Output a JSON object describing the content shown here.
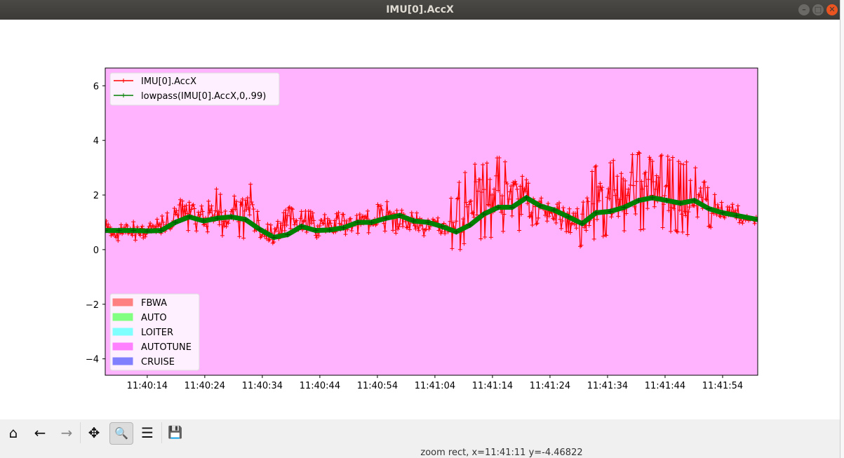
{
  "window": {
    "title": "IMU[0].AccX"
  },
  "toolbar": {
    "home": "⌂",
    "back": "←",
    "forward": "→",
    "pan": "✥",
    "zoom": "🔍",
    "configure": "☰",
    "save": "💾"
  },
  "status": "zoom rect, x=11:41:11 y=-4.46822",
  "chart_data": {
    "type": "line",
    "title": "",
    "xlabel": "",
    "ylabel": "",
    "x_unit": "seconds after 11:40:00",
    "xlim": [
      6.7,
      120.1
    ],
    "ylim": [
      -4.6,
      6.65
    ],
    "background": "#ffb3ff",
    "yticks": [
      6,
      4,
      2,
      0,
      -2,
      -4
    ],
    "ytick_labels": [
      "6",
      "4",
      "2",
      "0",
      "−2",
      "−4"
    ],
    "xticks": [
      14,
      24,
      34,
      44,
      54,
      64,
      74,
      84,
      94,
      104,
      114
    ],
    "xtick_labels": [
      "11:40:14",
      "11:40:24",
      "11:40:34",
      "11:40:44",
      "11:40:54",
      "11:41:04",
      "11:41:14",
      "11:41:24",
      "11:41:34",
      "11:41:44",
      "11:41:54"
    ],
    "x": [
      6.7,
      9.1,
      11.6,
      14,
      16.4,
      18.9,
      21.3,
      23.8,
      26.2,
      28.6,
      31.1,
      33.5,
      36,
      38.4,
      40.8,
      43.3,
      45.7,
      48.1,
      50.6,
      53,
      55.5,
      57.9,
      60.3,
      62.8,
      65.2,
      67.7,
      70.1,
      72.5,
      75,
      77.4,
      79.9,
      82.3,
      84.7,
      87.2,
      89.6,
      92,
      94.5,
      96.9,
      99.4,
      101.8,
      104.3,
      106.7,
      109.1,
      111.6,
      114,
      116.4,
      120.1
    ],
    "series": [
      {
        "name": "IMU[0].AccX",
        "color": "#ff0000",
        "kind": "envelope",
        "high": [
          1.1,
          1.1,
          1.1,
          1.0,
          1.2,
          1.7,
          2.1,
          1.6,
          2.3,
          1.7,
          3.1,
          1.2,
          0.9,
          1.6,
          1.5,
          1.5,
          1.3,
          1.4,
          1.5,
          1.6,
          1.8,
          1.5,
          1.4,
          1.3,
          1.2,
          2.5,
          3.1,
          3.3,
          3.5,
          3.3,
          2.6,
          1.9,
          1.8,
          1.6,
          2.5,
          3.1,
          3.2,
          3.7,
          3.6,
          3.4,
          3.5,
          3.3,
          3.2,
          2.2,
          1.8,
          1.7,
          1.5
        ],
        "low": [
          0.3,
          0.3,
          0.3,
          0.3,
          0.4,
          0.6,
          0.6,
          0.6,
          0.5,
          0.5,
          0.3,
          0.2,
          0.1,
          0.2,
          0.3,
          0.4,
          0.4,
          0.5,
          0.6,
          0.6,
          0.6,
          0.6,
          0.5,
          0.5,
          0.3,
          -0.15,
          0.3,
          0.4,
          0.5,
          0.6,
          0.8,
          0.9,
          0.9,
          0.6,
          0.0,
          0.4,
          0.5,
          0.6,
          0.6,
          0.8,
          0.7,
          0.5,
          0.6,
          0.8,
          0.9,
          0.9,
          0.8
        ]
      },
      {
        "name": "lowpass(IMU[0].AccX,0,.99)",
        "color": "#008000",
        "values": [
          0.7,
          0.7,
          0.7,
          0.68,
          0.7,
          1.0,
          1.2,
          1.05,
          1.15,
          1.2,
          1.1,
          0.75,
          0.45,
          0.55,
          0.85,
          0.7,
          0.72,
          0.8,
          1.0,
          1.0,
          1.15,
          1.25,
          1.05,
          1.0,
          0.85,
          0.65,
          0.9,
          1.3,
          1.55,
          1.55,
          1.9,
          1.6,
          1.45,
          1.2,
          0.95,
          1.35,
          1.4,
          1.55,
          1.8,
          1.9,
          1.8,
          1.7,
          1.8,
          1.5,
          1.35,
          1.25,
          1.1
        ]
      }
    ],
    "legend": {
      "placement": "upper-left",
      "entries": [
        "IMU[0].AccX",
        "lowpass(IMU[0].AccX,0,.99)"
      ]
    },
    "mode_legend": {
      "placement": "lower-left",
      "entries": [
        {
          "label": "FBWA",
          "color": "#ff8080"
        },
        {
          "label": "AUTO",
          "color": "#80ff80"
        },
        {
          "label": "LOITER",
          "color": "#80ffff"
        },
        {
          "label": "AUTOTUNE",
          "color": "#ff80ff"
        },
        {
          "label": "CRUISE",
          "color": "#8080ff"
        }
      ]
    }
  }
}
